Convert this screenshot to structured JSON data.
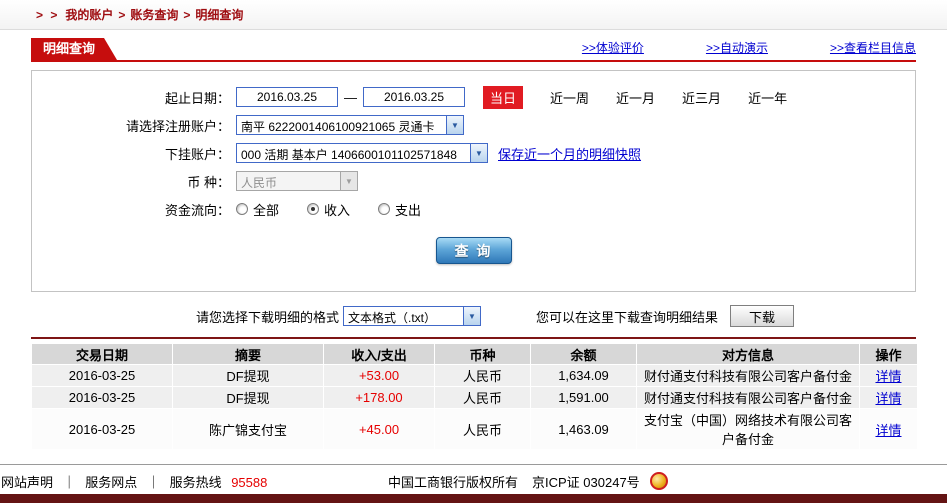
{
  "breadcrumb": {
    "prefix": "> >",
    "sep": ">",
    "items": [
      "我的账户",
      "账务查询",
      "明细查询"
    ]
  },
  "header": {
    "tab_title": "明细查询",
    "links": [
      ">>体验评价",
      ">>自动演示",
      ">>查看栏目信息"
    ]
  },
  "form": {
    "date_label": "起止日期：",
    "date_from": "2016.03.25",
    "date_to": "2016.03.25",
    "date_sep": "—",
    "quick_current": "当日",
    "quick_ranges": [
      "近一周",
      "近一月",
      "近三月",
      "近一年"
    ],
    "account_label": "请选择注册账户：",
    "account_value": "南平 6222001406100921065 灵通卡",
    "sub_account_label": "下挂账户：",
    "sub_account_value": "000 活期 基本户 1406600101102571848",
    "snapshot_link": "保存近一个月的明细快照",
    "currency_label": "币 种：",
    "currency_value": "人民币",
    "flow_label": "资金流向：",
    "flow_options": [
      "全部",
      "收入",
      "支出"
    ],
    "flow_selected": "收入",
    "query_button": "查 询"
  },
  "download": {
    "format_label": "请您选择下载明细的格式",
    "format_value": "文本格式（.txt）",
    "hint": "您可以在这里下载查询明细结果",
    "button": "下载"
  },
  "table": {
    "headers": [
      "交易日期",
      "摘要",
      "收入/支出",
      "币种",
      "余额",
      "对方信息",
      "操作"
    ],
    "rows": [
      {
        "date": "2016-03-25",
        "summary": "DF提现",
        "amount": "+53.00",
        "currency": "人民币",
        "balance": "1,634.09",
        "counterparty": "财付通支付科技有限公司客户备付金",
        "action": "详情"
      },
      {
        "date": "2016-03-25",
        "summary": "DF提现",
        "amount": "+178.00",
        "currency": "人民币",
        "balance": "1,591.00",
        "counterparty": "财付通支付科技有限公司客户备付金",
        "action": "详情"
      },
      {
        "date": "2016-03-25",
        "summary": "陈广锦支付宝",
        "amount": "+45.00",
        "currency": "人民币",
        "balance": "1,463.09",
        "counterparty": "支付宝（中国）网络技术有限公司客户备付金",
        "action": "详情"
      }
    ]
  },
  "footer": {
    "links": [
      "网站声明",
      "服务网点"
    ],
    "sep": "｜",
    "hotline_label": "服务热线",
    "hotline_number": "95588",
    "copyright": "中国工商银行版权所有",
    "icp": "京ICP证 030247号"
  },
  "icons": {
    "chevron_down": "▼"
  },
  "colors": {
    "accent_red": "#c60d0d",
    "highlight_red": "#e11b22",
    "link_blue": "#0000d0",
    "amount_red": "#e60000",
    "footer_bar": "#641414"
  }
}
